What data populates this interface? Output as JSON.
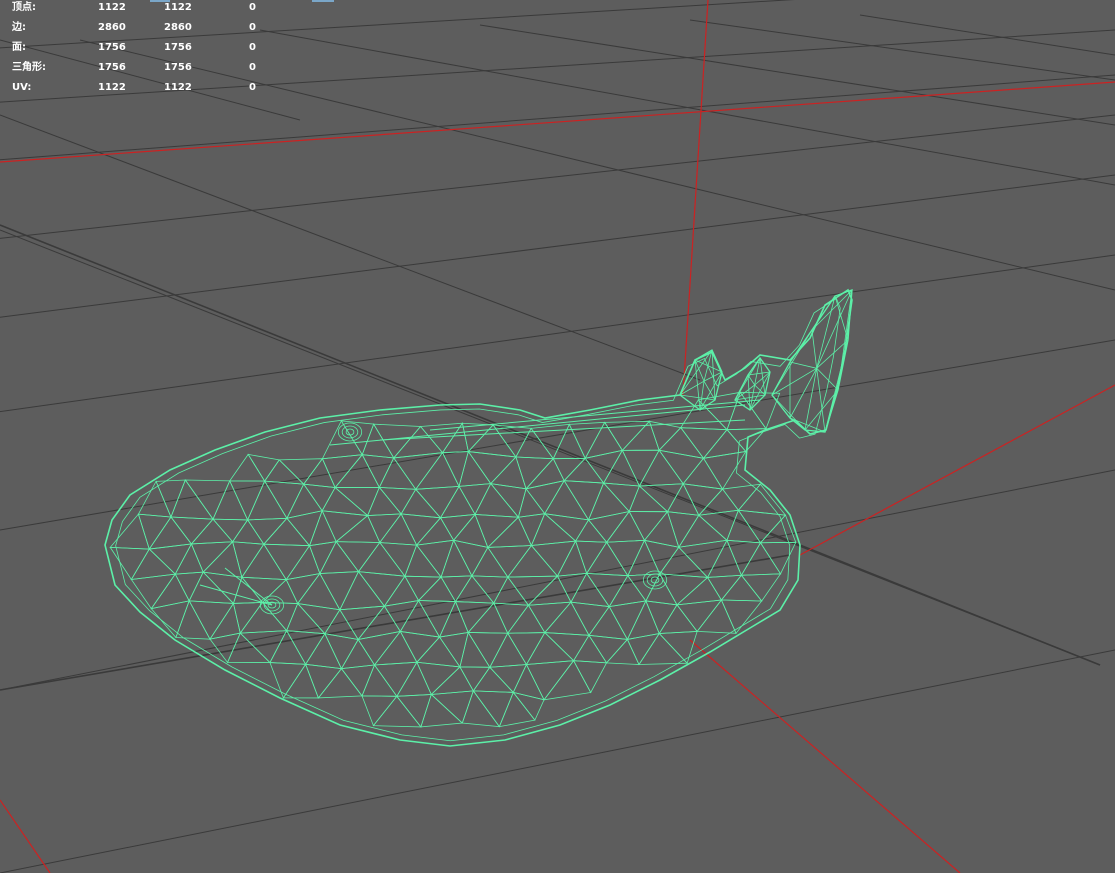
{
  "viewport": {
    "background": "#5d5d5d",
    "grid_color": "#3a3a3a",
    "axis_color": "#cc2222",
    "wireframe_color": "#5cf0a8"
  },
  "heads_up_display": {
    "rows": [
      {
        "label": "顶点:",
        "a": "1122",
        "b": "1122",
        "c": "0"
      },
      {
        "label": "边:",
        "a": "2860",
        "b": "2860",
        "c": "0"
      },
      {
        "label": "面:",
        "a": "1756",
        "b": "1756",
        "c": "0"
      },
      {
        "label": "三角形:",
        "a": "1756",
        "b": "1756",
        "c": "0"
      },
      {
        "label": "UV:",
        "a": "1122",
        "b": "1122",
        "c": "0"
      }
    ]
  }
}
